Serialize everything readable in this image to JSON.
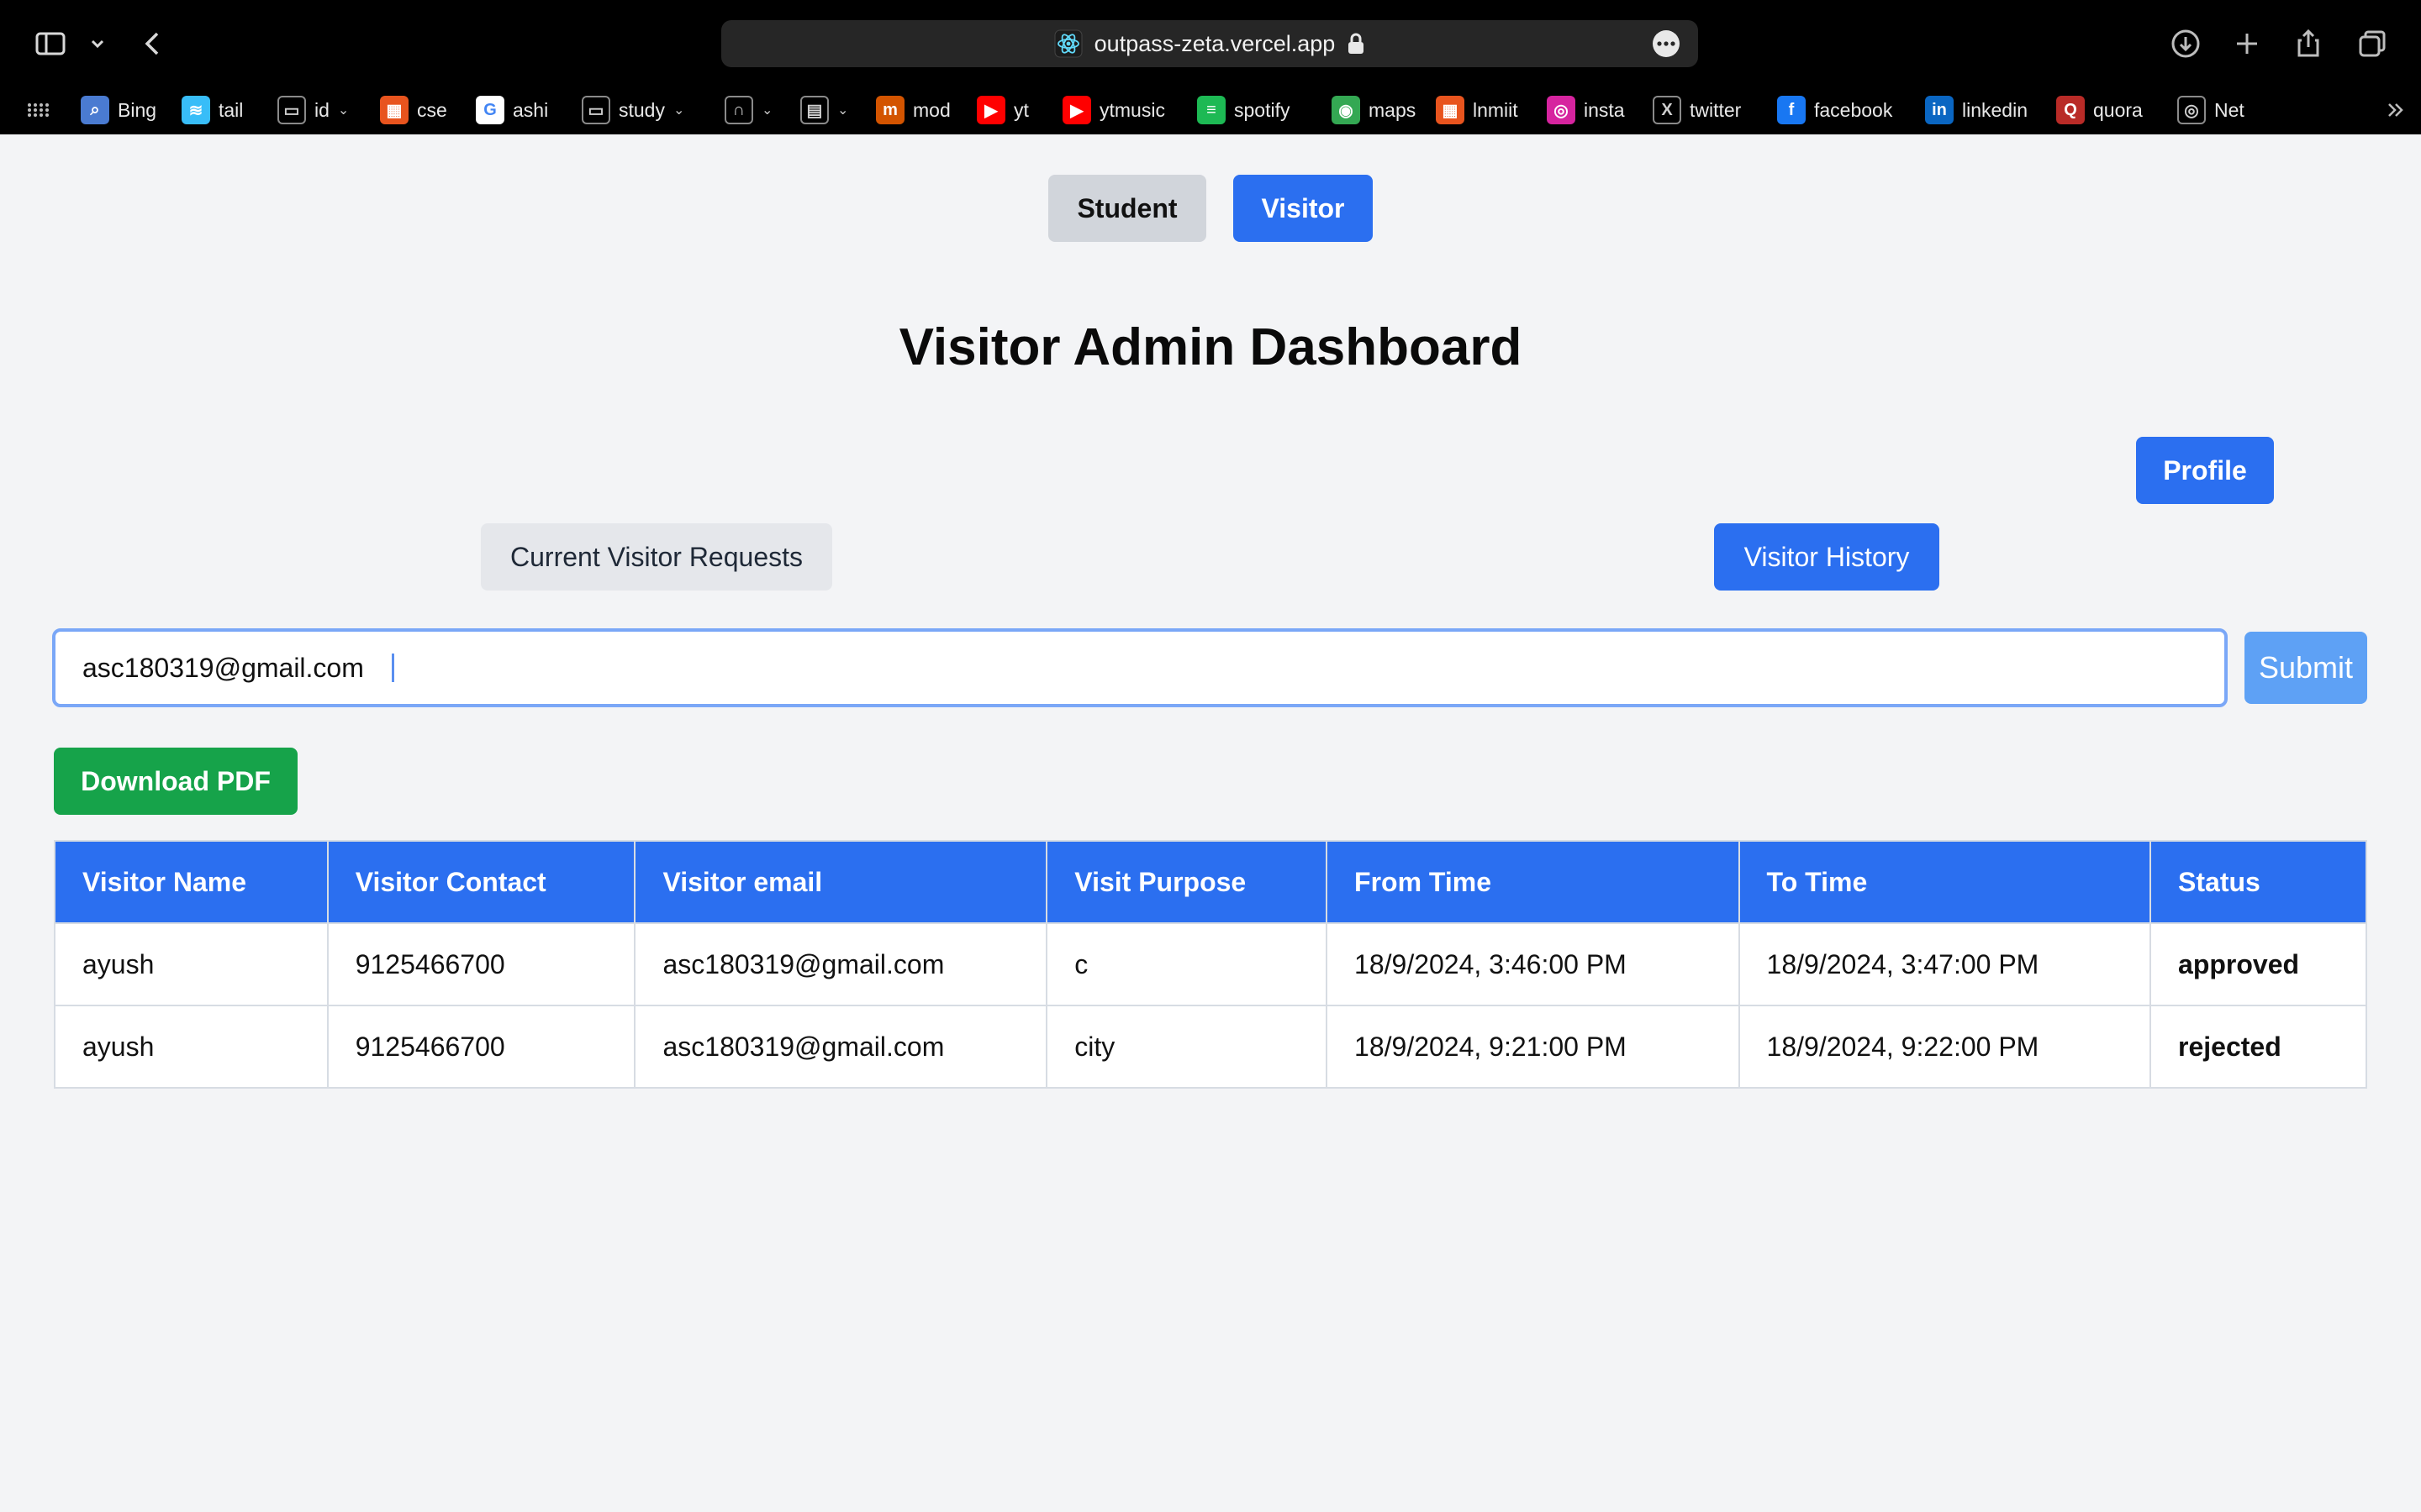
{
  "browser": {
    "url": "outpass-zeta.vercel.app",
    "bookmarks": [
      {
        "label": "Bing",
        "icon": "bing-icon",
        "color": "#4a7bd1"
      },
      {
        "label": "tail",
        "icon": "tailwind-icon",
        "color": "#38bdf8"
      },
      {
        "label": "id",
        "icon": "folder-icon",
        "color": "#000000"
      },
      {
        "label": "cse",
        "icon": "cse-icon",
        "color": "#e8541e"
      },
      {
        "label": "ashi",
        "icon": "google-icon",
        "color": "#ffffff"
      },
      {
        "label": "study",
        "icon": "folder-icon",
        "color": "#000000"
      },
      {
        "label": "",
        "icon": "headphones-icon",
        "color": "#000000"
      },
      {
        "label": "",
        "icon": "clapperboard-icon",
        "color": "#000000"
      },
      {
        "label": "mod",
        "icon": "mod-icon",
        "color": "#d35400"
      },
      {
        "label": "yt",
        "icon": "youtube-icon",
        "color": "#ff0000"
      },
      {
        "label": "ytmusic",
        "icon": "ytmusic-icon",
        "color": "#ff0000"
      },
      {
        "label": "spotify",
        "icon": "spotify-icon",
        "color": "#1db954"
      },
      {
        "label": "maps",
        "icon": "maps-icon",
        "color": "#34a853"
      },
      {
        "label": "lnmiit",
        "icon": "lnmiit-icon",
        "color": "#e8541e"
      },
      {
        "label": "insta",
        "icon": "instagram-icon",
        "color": "#d6249f"
      },
      {
        "label": "twitter",
        "icon": "x-icon",
        "color": "#000000"
      },
      {
        "label": "facebook",
        "icon": "facebook-icon",
        "color": "#1877f2"
      },
      {
        "label": "linkedin",
        "icon": "linkedin-icon",
        "color": "#0a66c2"
      },
      {
        "label": "quora",
        "icon": "quora-icon",
        "color": "#b92b27"
      },
      {
        "label": "Net",
        "icon": "globe-icon",
        "color": "#000000"
      }
    ]
  },
  "nav": {
    "student_label": "Student",
    "visitor_label": "Visitor"
  },
  "page": {
    "title": "Visitor Admin Dashboard",
    "profile_label": "Profile",
    "current_requests_label": "Current Visitor Requests",
    "history_label": "Visitor History"
  },
  "search": {
    "value": "asc180319@gmail.com",
    "submit_label": "Submit"
  },
  "download_label": "Download PDF",
  "table": {
    "headers": [
      "Visitor Name",
      "Visitor Contact",
      "Visitor email",
      "Visit Purpose",
      "From Time",
      "To Time",
      "Status"
    ],
    "rows": [
      [
        "ayush",
        "9125466700",
        "asc180319@gmail.com",
        "c",
        "18/9/2024, 3:46:00 PM",
        "18/9/2024, 3:47:00 PM",
        "approved"
      ],
      [
        "ayush",
        "9125466700",
        "asc180319@gmail.com",
        "city",
        "18/9/2024, 9:21:00 PM",
        "18/9/2024, 9:22:00 PM",
        "rejected"
      ]
    ]
  },
  "colors": {
    "primary": "#2b6ff0",
    "approved": "#16a34a",
    "rejected": "#dc2626",
    "download": "#16a34a"
  }
}
